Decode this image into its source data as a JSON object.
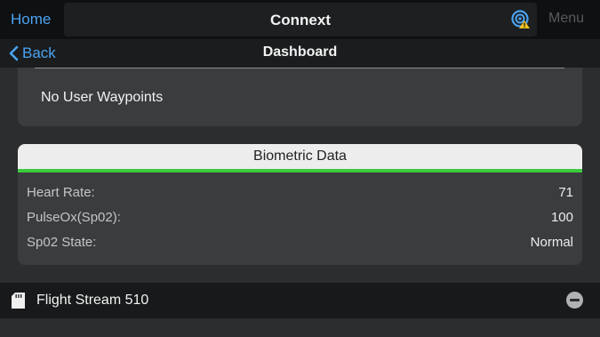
{
  "topbar": {
    "home_label": "Home",
    "title": "Connext",
    "menu_label": "Menu",
    "status_icon": "signal-warning-icon",
    "accent_color": "#4aa3f0",
    "warning_color": "#f5c518"
  },
  "navbar": {
    "back_label": "Back",
    "title": "Dashboard"
  },
  "waypoints": {
    "text": "No User Waypoints"
  },
  "biometric": {
    "title": "Biometric Data",
    "accent_color": "#3ec93e",
    "rows": [
      {
        "label": "Heart Rate:",
        "value": "71"
      },
      {
        "label": "PulseOx(Sp02):",
        "value": "100"
      },
      {
        "label": "Sp02 State:",
        "value": "Normal"
      }
    ]
  },
  "device": {
    "icon": "sd-card-icon",
    "name": "Flight Stream 510",
    "action_icon": "remove-circle-icon"
  }
}
